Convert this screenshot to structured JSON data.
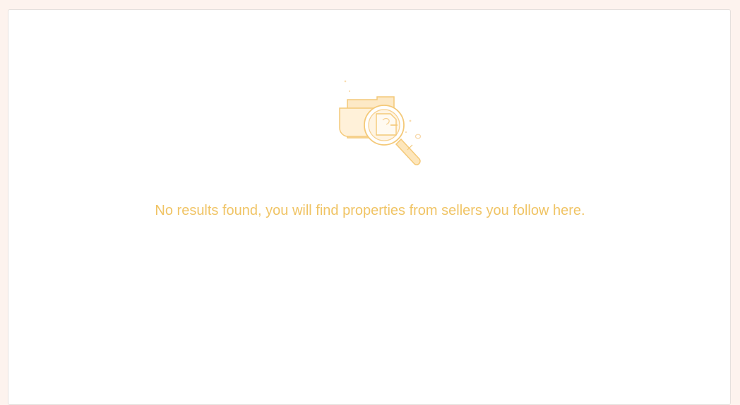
{
  "empty_state": {
    "message": "No results found, you will find properties from sellers you follow here.",
    "illustration_icon": "folder-search-icon",
    "accent_color": "#f0c465",
    "illustration_fill": "#fde6bb",
    "illustration_stroke": "#f4c979"
  },
  "page": {
    "background_color": "#fdf3ee"
  }
}
